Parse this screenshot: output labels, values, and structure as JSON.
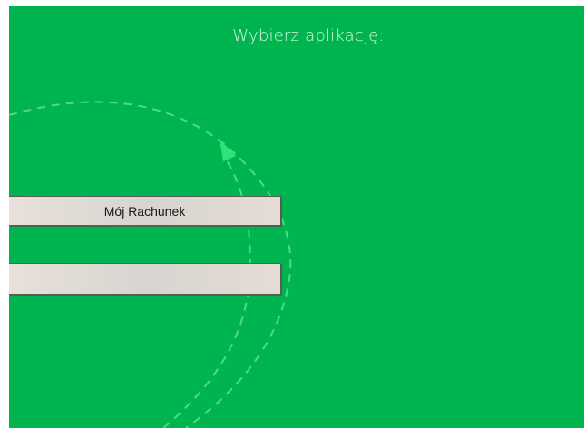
{
  "screen": {
    "title": "Wybierz aplikację:",
    "background_color": "#00b44f"
  },
  "apps": [
    {
      "label": "Mój Rachunek"
    },
    {
      "label": ""
    }
  ],
  "decoration": {
    "arrow_color": "#2ee37a",
    "dash_color": "#5fe08f"
  }
}
